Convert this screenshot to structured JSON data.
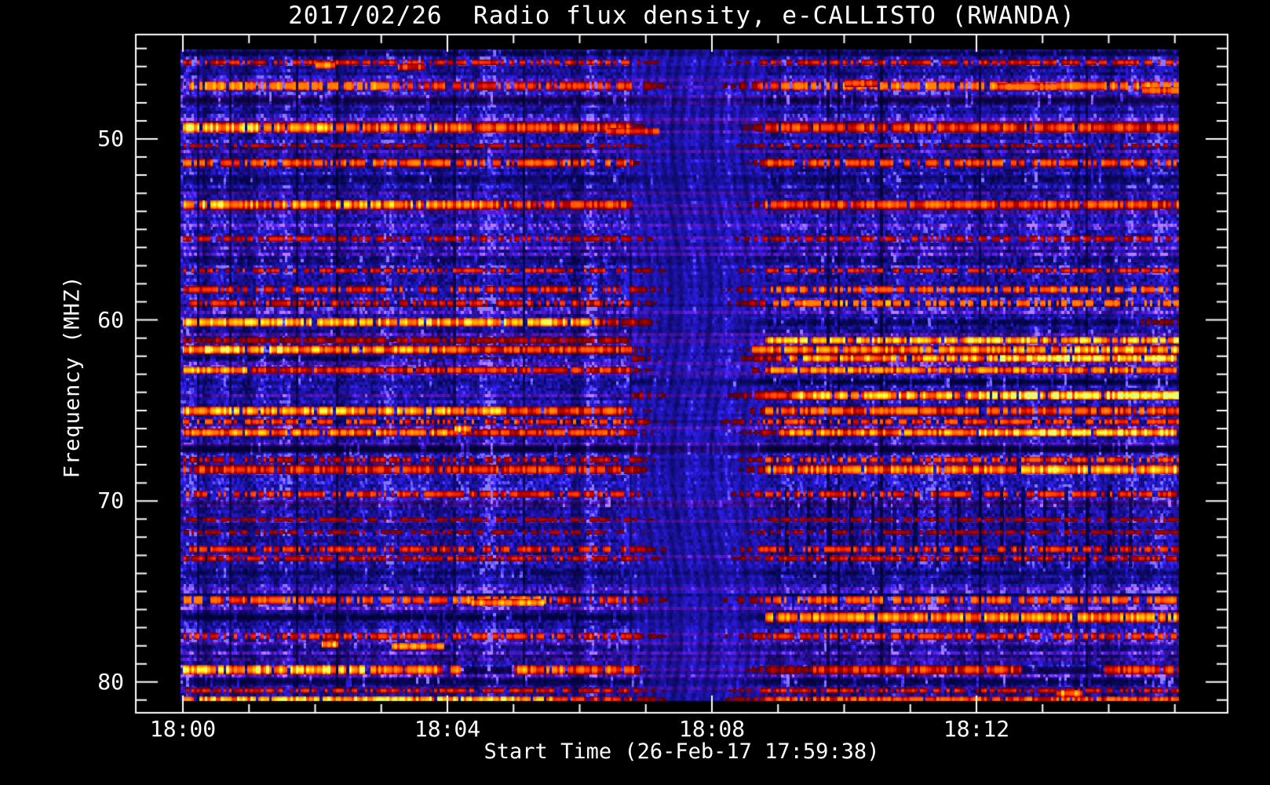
{
  "chart_data": {
    "type": "heatmap",
    "subtype": "radio-spectrogram",
    "title": "2017/02/26  Radio flux density, e-CALLISTO (RWANDA)",
    "xlabel": "Start Time (26-Feb-17 17:59:38)",
    "ylabel": "Frequency (MHZ)",
    "x_tick_labels": [
      "18:00",
      "18:04",
      "18:08",
      "18:12"
    ],
    "x_tick_minutes": [
      0,
      4,
      8,
      12
    ],
    "x_minor_interval_min": 1,
    "x_minor_minutes": [
      1,
      2,
      3,
      5,
      6,
      7,
      9,
      10,
      11,
      13,
      14,
      15
    ],
    "y_tick_labels": [
      "50",
      "60",
      "70",
      "80"
    ],
    "y_tick_mhz": [
      50,
      60,
      70,
      80
    ],
    "y_minor_interval_mhz": 1,
    "y_minor_range_mhz": [
      45,
      81
    ],
    "data_time_span_min": [
      0,
      15.06
    ],
    "data_freq_span_mhz": [
      45.0,
      81.05
    ],
    "grid": false,
    "legend": "none",
    "colors": {
      "background": "#000000",
      "axis_and_text": "#ffffff",
      "base_blue": "#2222cc",
      "dark_band": "#000008",
      "hot_red": "#dd2200",
      "hot_orange": "#ff8800",
      "hot_yellow": "#ffee55",
      "yellow_green": "#d6e838",
      "purple_rows": "#5a2ab0"
    },
    "disturbance": {
      "time_min": [
        6.7,
        8.8
      ],
      "description": "broadband wavy blue smear; horizontal RFI bands fade out around 18:07-18:08"
    },
    "dark_column_region": {
      "time_min": [
        9.1,
        14.6
      ],
      "freq_mhz": [
        69.2,
        73.6
      ],
      "period_min": 0.325,
      "description": "periodic thin dark vertical gaps in lower-right quadrant"
    },
    "rfi_bands": [
      {
        "f": 45.25,
        "hw": 0.18,
        "style": "dark",
        "segs": [
          [
            0,
            15.1,
            0.7
          ]
        ]
      },
      {
        "f": 45.75,
        "hw": 0.15,
        "style": "red",
        "segs": [
          [
            0,
            15.1,
            0.45
          ]
        ]
      },
      {
        "f": 47.05,
        "hw": 0.25,
        "style": "red",
        "segs": [
          [
            0,
            3.2,
            0.85
          ],
          [
            3.2,
            9,
            0.55
          ],
          [
            9,
            15.1,
            0.75
          ]
        ]
      },
      {
        "f": 47.85,
        "hw": 0.35,
        "style": "dark",
        "segs": [
          [
            0,
            15.1,
            0.8
          ]
        ]
      },
      {
        "f": 49.35,
        "hw": 0.28,
        "style": "hot",
        "segs": [
          [
            0,
            1.1,
            1.05
          ],
          [
            1.1,
            2.6,
            0.92
          ],
          [
            2.6,
            4.2,
            0.72
          ],
          [
            4.2,
            6.8,
            0.6
          ],
          [
            6.8,
            8.8,
            0.3
          ],
          [
            8.8,
            15.1,
            0.58
          ]
        ]
      },
      {
        "f": 50.35,
        "hw": 0.13,
        "style": "red",
        "segs": [
          [
            0,
            15.1,
            0.35
          ]
        ]
      },
      {
        "f": 51.3,
        "hw": 0.22,
        "style": "red",
        "segs": [
          [
            0,
            6.8,
            0.62
          ],
          [
            6.8,
            8.8,
            0.3
          ],
          [
            8.8,
            15.1,
            0.58
          ]
        ]
      },
      {
        "f": 52.2,
        "hw": 0.3,
        "style": "dark",
        "segs": [
          [
            0,
            15.1,
            0.7
          ]
        ]
      },
      {
        "f": 53.6,
        "hw": 0.26,
        "style": "hot",
        "segs": [
          [
            0,
            0.6,
            1.0
          ],
          [
            0.6,
            4.5,
            0.82
          ],
          [
            4.5,
            6.8,
            0.62
          ],
          [
            6.8,
            8.8,
            0.3
          ],
          [
            8.8,
            15.1,
            0.62
          ]
        ]
      },
      {
        "f": 55.5,
        "hw": 0.18,
        "style": "red",
        "segs": [
          [
            0,
            15.1,
            0.4
          ]
        ]
      },
      {
        "f": 56.65,
        "hw": 0.25,
        "style": "dark",
        "segs": [
          [
            0,
            15.1,
            0.6
          ]
        ]
      },
      {
        "f": 57.25,
        "hw": 0.16,
        "style": "red",
        "segs": [
          [
            0,
            15.1,
            0.45
          ]
        ]
      },
      {
        "f": 58.3,
        "hw": 0.2,
        "style": "red",
        "segs": [
          [
            0,
            8.8,
            0.5
          ],
          [
            8.8,
            15.1,
            0.68
          ]
        ]
      },
      {
        "f": 59.05,
        "hw": 0.2,
        "style": "red",
        "segs": [
          [
            0,
            8.8,
            0.45
          ],
          [
            8.8,
            15.1,
            0.78
          ]
        ]
      },
      {
        "f": 60.1,
        "hw": 0.24,
        "style": "hot",
        "segs": [
          [
            0,
            6.3,
            0.95
          ],
          [
            6.3,
            7.2,
            0.45
          ],
          [
            7.2,
            14.4,
            -0.75
          ],
          [
            14.4,
            15.1,
            0.25
          ]
        ]
      },
      {
        "f": 60.6,
        "hw": 0.14,
        "style": "dark",
        "segs": [
          [
            0,
            15.1,
            0.5
          ]
        ]
      },
      {
        "f": 61.1,
        "hw": 0.2,
        "style": "hot",
        "segs": [
          [
            0,
            6.8,
            0.35
          ],
          [
            6.8,
            8.8,
            0.18
          ],
          [
            8.8,
            15.1,
            0.92
          ]
        ]
      },
      {
        "f": 61.62,
        "hw": 0.22,
        "style": "hot",
        "segs": [
          [
            0,
            1.6,
            1.05
          ],
          [
            1.6,
            4.2,
            0.82
          ],
          [
            4.2,
            6.8,
            0.58
          ],
          [
            6.8,
            8.6,
            0.3
          ],
          [
            8.6,
            12.6,
            0.8
          ],
          [
            12.6,
            15.1,
            0.95
          ]
        ]
      },
      {
        "f": 62.1,
        "hw": 0.2,
        "style": "hot",
        "segs": [
          [
            0,
            3,
            -0.8
          ],
          [
            3,
            6.8,
            0.15
          ],
          [
            6.8,
            9,
            0.4
          ],
          [
            9,
            12.2,
            0.85
          ],
          [
            12.2,
            15.1,
            1.12
          ]
        ]
      },
      {
        "f": 62.75,
        "hw": 0.2,
        "style": "hot",
        "segs": [
          [
            0,
            1,
            0.88
          ],
          [
            1,
            6.8,
            0.55
          ],
          [
            6.8,
            8.8,
            0.3
          ],
          [
            8.8,
            15.1,
            0.78
          ]
        ]
      },
      {
        "f": 63.4,
        "hw": 0.25,
        "style": "dark",
        "segs": [
          [
            0,
            6.8,
            0.45
          ],
          [
            6.8,
            15.1,
            0.95
          ]
        ]
      },
      {
        "f": 64.15,
        "hw": 0.24,
        "style": "hot",
        "segs": [
          [
            0,
            6.8,
            0.12
          ],
          [
            6.8,
            9.2,
            0.5
          ],
          [
            9.2,
            12,
            0.95
          ],
          [
            12,
            15.1,
            1.12
          ]
        ]
      },
      {
        "f": 65.0,
        "hw": 0.24,
        "style": "hot",
        "segs": [
          [
            0,
            4.8,
            0.9
          ],
          [
            4.8,
            6.8,
            0.62
          ],
          [
            6.8,
            8.8,
            0.3
          ],
          [
            8.8,
            15.1,
            0.66
          ]
        ]
      },
      {
        "f": 65.6,
        "hw": 0.18,
        "style": "red",
        "segs": [
          [
            0,
            15.1,
            0.55
          ]
        ]
      },
      {
        "f": 66.2,
        "hw": 0.2,
        "style": "hot",
        "segs": [
          [
            0,
            4,
            0.8
          ],
          [
            4,
            6.8,
            0.55
          ],
          [
            6.8,
            9,
            0.35
          ],
          [
            9,
            12,
            0.8
          ],
          [
            12,
            15.1,
            1.05
          ]
        ]
      },
      {
        "f": 67.1,
        "hw": 0.32,
        "style": "dark",
        "segs": [
          [
            0,
            15.1,
            0.85
          ]
        ]
      },
      {
        "f": 67.7,
        "hw": 0.18,
        "style": "red",
        "segs": [
          [
            0,
            8.8,
            0.4
          ],
          [
            8.8,
            15.1,
            0.55
          ]
        ]
      },
      {
        "f": 68.25,
        "hw": 0.26,
        "style": "hot",
        "segs": [
          [
            0,
            6.8,
            0.55
          ],
          [
            6.8,
            8.8,
            0.35
          ],
          [
            8.8,
            12.5,
            0.78
          ],
          [
            12.5,
            15.1,
            0.95
          ]
        ]
      },
      {
        "f": 69.6,
        "hw": 0.2,
        "style": "red",
        "segs": [
          [
            0,
            15.1,
            0.5
          ]
        ]
      },
      {
        "f": 70.15,
        "hw": 0.22,
        "style": "dark",
        "segs": [
          [
            0,
            15.1,
            0.55
          ]
        ]
      },
      {
        "f": 71.0,
        "hw": 0.14,
        "style": "red",
        "segs": [
          [
            0,
            15.1,
            0.32
          ]
        ]
      },
      {
        "f": 71.7,
        "hw": 0.14,
        "style": "red",
        "segs": [
          [
            0,
            15.1,
            0.32
          ]
        ]
      },
      {
        "f": 72.65,
        "hw": 0.2,
        "style": "red",
        "segs": [
          [
            0,
            15.1,
            0.5
          ]
        ]
      },
      {
        "f": 73.15,
        "hw": 0.16,
        "style": "red",
        "segs": [
          [
            0,
            15.1,
            0.42
          ]
        ]
      },
      {
        "f": 73.95,
        "hw": 0.28,
        "style": "dark",
        "segs": [
          [
            0,
            15.1,
            0.55
          ]
        ]
      },
      {
        "f": 75.45,
        "hw": 0.24,
        "style": "red",
        "segs": [
          [
            0,
            0.5,
            0.85
          ],
          [
            0.5,
            4.3,
            0.6
          ],
          [
            4.3,
            5.5,
            0.85
          ],
          [
            5.5,
            8.8,
            0.5
          ],
          [
            8.8,
            15.1,
            0.62
          ]
        ]
      },
      {
        "f": 76.4,
        "hw": 0.28,
        "style": "hot",
        "segs": [
          [
            0,
            8.8,
            -0.85
          ],
          [
            8.8,
            15.1,
            0.8
          ]
        ]
      },
      {
        "f": 77.45,
        "hw": 0.2,
        "style": "red",
        "segs": [
          [
            0,
            15.1,
            0.5
          ]
        ]
      },
      {
        "f": 78.05,
        "hw": 0.24,
        "style": "dark",
        "segs": [
          [
            0,
            15.1,
            0.5
          ]
        ]
      },
      {
        "f": 79.3,
        "hw": 0.26,
        "style": "hot",
        "segs": [
          [
            0,
            2.8,
            1.0
          ],
          [
            2.8,
            4.2,
            0.78
          ],
          [
            4.2,
            5,
            -0.85
          ],
          [
            5,
            6.9,
            0.72
          ],
          [
            6.9,
            9.5,
            0.3
          ],
          [
            9.5,
            12.7,
            0.55
          ],
          [
            12.7,
            13.9,
            -0.8
          ],
          [
            13.9,
            15.1,
            0.6
          ]
        ]
      },
      {
        "f": 79.95,
        "hw": 0.28,
        "style": "dark",
        "segs": [
          [
            0,
            15.1,
            0.85
          ]
        ]
      },
      {
        "f": 80.45,
        "hw": 0.14,
        "style": "red",
        "segs": [
          [
            0,
            15.1,
            0.45
          ]
        ]
      },
      {
        "f": 80.95,
        "hw": 0.2,
        "style": "hot",
        "segs": [
          [
            0,
            5.6,
            0.95
          ],
          [
            5.6,
            8.8,
            0.5
          ],
          [
            8.8,
            15.1,
            0.6
          ]
        ]
      }
    ],
    "patches": [
      {
        "f": 45.9,
        "t": [
          2.0,
          2.3
        ],
        "i": 0.95,
        "style": "hot"
      },
      {
        "f": 46.0,
        "t": [
          3.25,
          3.65
        ],
        "i": 0.6,
        "style": "red"
      },
      {
        "f": 49.55,
        "t": [
          6.4,
          7.2
        ],
        "i": 0.62,
        "style": "red"
      },
      {
        "f": 46.9,
        "t": [
          10.0,
          10.5
        ],
        "i": 0.7,
        "style": "red"
      },
      {
        "f": 47.1,
        "t": [
          12.3,
          13.2
        ],
        "i": 0.8,
        "style": "red"
      },
      {
        "f": 47.3,
        "t": [
          14.5,
          15.06
        ],
        "i": 0.75,
        "style": "red"
      },
      {
        "f": 66.0,
        "t": [
          4.1,
          4.35
        ],
        "i": 1.0,
        "style": "hot"
      },
      {
        "f": 75.6,
        "t": [
          4.35,
          5.45
        ],
        "i": 0.88,
        "style": "hot"
      },
      {
        "f": 77.9,
        "t": [
          2.1,
          2.35
        ],
        "i": 1.0,
        "style": "hot"
      },
      {
        "f": 78.0,
        "t": [
          3.15,
          3.95
        ],
        "i": 0.8,
        "style": "hot"
      },
      {
        "f": 80.6,
        "t": [
          13.2,
          13.6
        ],
        "i": 0.85,
        "style": "hot"
      }
    ]
  }
}
